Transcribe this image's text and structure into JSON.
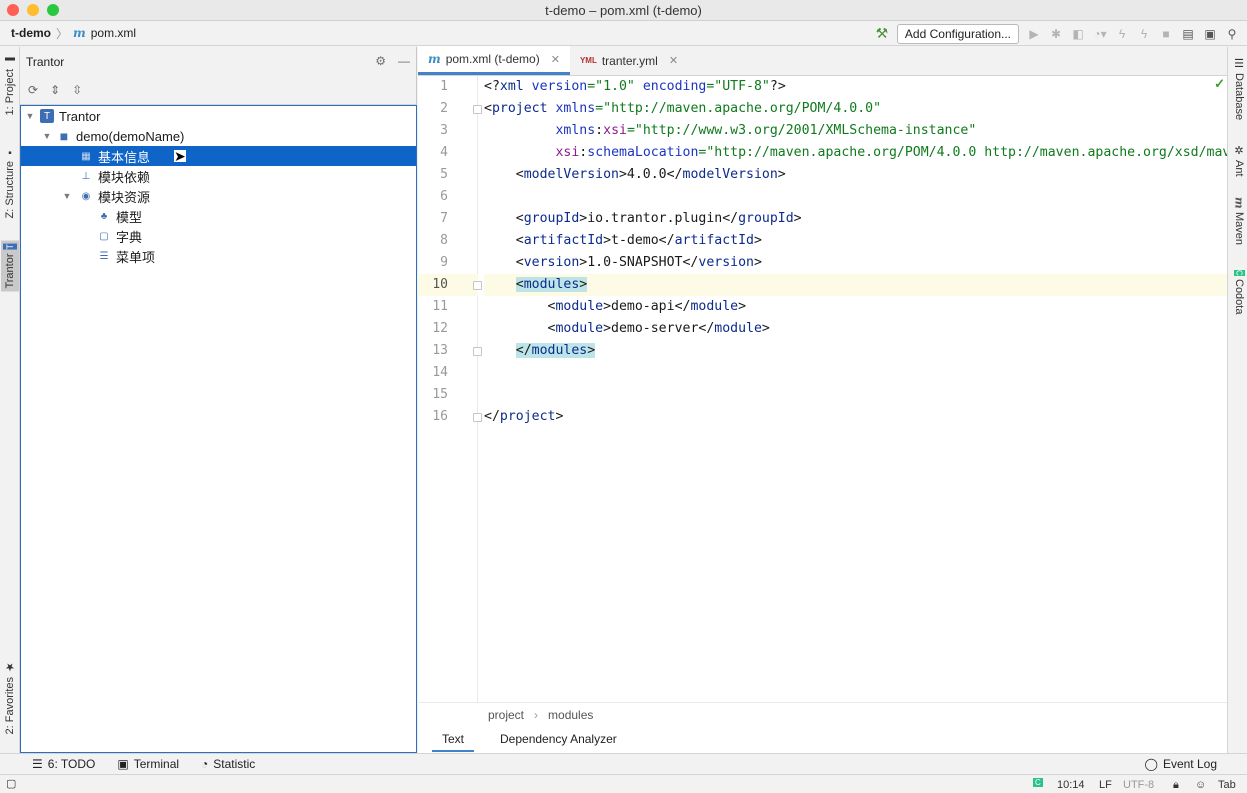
{
  "window": {
    "title": "t-demo – pom.xml (t-demo)"
  },
  "breadcrumb": {
    "project": "t-demo",
    "file": "pom.xml"
  },
  "toolbar": {
    "add_config_label": "Add Configuration..."
  },
  "left_tabs": {
    "project": "1: Project",
    "structure": "Z: Structure",
    "tantor": "Trantor",
    "favorites": "2: Favorites"
  },
  "right_tabs": {
    "database": "Database",
    "ant": "Ant",
    "maven": "Maven",
    "codota": "Codota"
  },
  "panel": {
    "title": "Trantor",
    "tree": [
      {
        "label": "Trantor"
      },
      {
        "label": "demo(demoName)"
      },
      {
        "label": "基本信息"
      },
      {
        "label": "模块依赖"
      },
      {
        "label": "模块资源"
      },
      {
        "label": "模型"
      },
      {
        "label": "字典"
      },
      {
        "label": "菜单项"
      }
    ]
  },
  "editor": {
    "tabs": [
      {
        "label": "pom.xml (t-demo)"
      },
      {
        "label": "tranter.yml"
      }
    ],
    "line_numbers": [
      "1",
      "2",
      "3",
      "4",
      "5",
      "6",
      "7",
      "8",
      "9",
      "10",
      "11",
      "12",
      "13",
      "14",
      "15",
      "16"
    ],
    "breadcrumb": [
      "project",
      "modules"
    ],
    "bottom_tabs": [
      "Text",
      "Dependency Analyzer"
    ]
  },
  "bottom_bar": {
    "todo": "6: TODO",
    "terminal": "Terminal",
    "statistic": "Statistic",
    "event_log": "Event Log"
  },
  "status_bar": {
    "position": "10:14",
    "line_sep": "LF",
    "encoding": "UTF-8",
    "indent": "Tab"
  },
  "colors": {
    "selection": "#0f64c8",
    "accent": "#4083c9",
    "tag": "#0c2b8c",
    "string": "#107a1d"
  }
}
